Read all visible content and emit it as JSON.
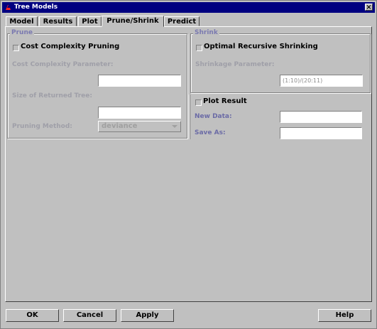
{
  "window": {
    "title": "Tree Models",
    "close_glyph": "×"
  },
  "tabs": [
    {
      "label": "Model"
    },
    {
      "label": "Results"
    },
    {
      "label": "Plot"
    },
    {
      "label": "Prune/Shrink"
    },
    {
      "label": "Predict"
    }
  ],
  "prune": {
    "group_label": "Prune",
    "checkbox_label": "Cost Complexity Pruning",
    "checkbox_checked": false,
    "cost_param_label": "Cost Complexity Parameter:",
    "cost_param_value": "",
    "size_label": "Size of Returned Tree:",
    "size_value": "",
    "method_label": "Pruning Method:",
    "method_value": "deviance"
  },
  "shrink": {
    "group_label": "Shrink",
    "checkbox_label": "Optimal Recursive Shrinking",
    "checkbox_checked": false,
    "param_label": "Shrinkage Parameter:",
    "param_value": "(1:10)/(20:11)"
  },
  "output": {
    "plot_label": "Plot Result",
    "plot_checked": false,
    "new_data_label": "New Data:",
    "new_data_value": "",
    "save_as_label": "Save As:",
    "save_as_value": ""
  },
  "buttons": {
    "ok": "OK",
    "cancel": "Cancel",
    "apply": "Apply",
    "help": "Help"
  },
  "colors": {
    "titlebar": "#000080",
    "face": "#c0c0c0",
    "group_label": "#7a79b0",
    "disabled_text": "#9f9fa8"
  }
}
